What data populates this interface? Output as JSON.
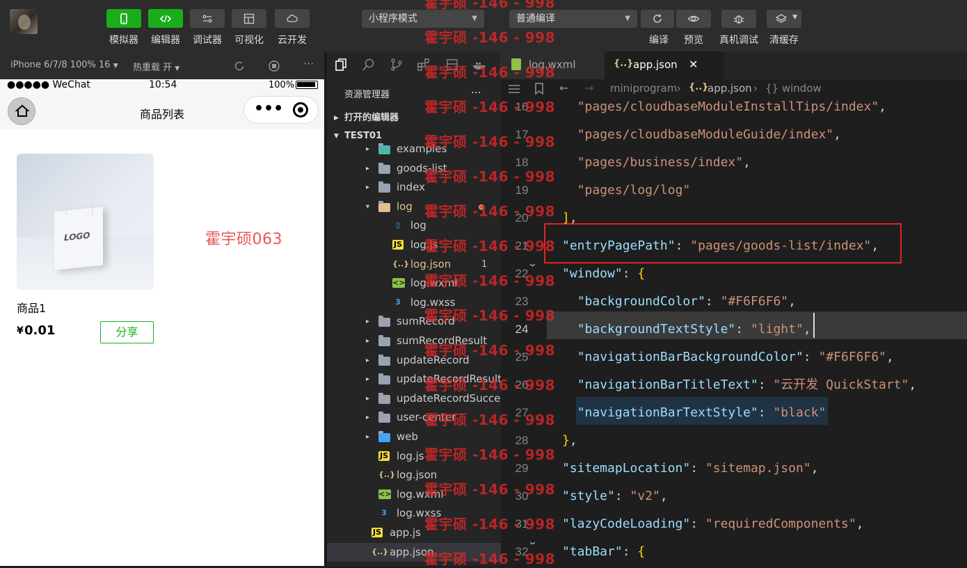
{
  "toolbar": {
    "buttons": [
      {
        "label": "模拟器",
        "icon": "phone-icon",
        "active": true
      },
      {
        "label": "编辑器",
        "icon": "code-icon",
        "active": true
      },
      {
        "label": "调试器",
        "icon": "debug-icon",
        "active": false
      },
      {
        "label": "可视化",
        "icon": "layout-icon",
        "active": false
      },
      {
        "label": "云开发",
        "icon": "cloud-icon",
        "active": false
      }
    ],
    "mode_select": "小程序模式",
    "compile_select": "普通编译",
    "actions": [
      {
        "label": "编译",
        "icon": "refresh-icon"
      },
      {
        "label": "预览",
        "icon": "eye-icon"
      },
      {
        "label": "真机调试",
        "icon": "bug-icon"
      },
      {
        "label": "清缓存",
        "icon": "layers-icon"
      }
    ]
  },
  "watermark": {
    "text": "霍宇硕 -146 - 998",
    "phone_text": "霍宇硕063"
  },
  "simulator": {
    "device": "iPhone 6/7/8 100% 16",
    "hot_reload": "热重载 开",
    "status": {
      "carrier": "●●●●● WeChat",
      "time": "10:54",
      "battery": "100%"
    },
    "nav_title": "商品列表",
    "product": {
      "name": "商品1",
      "price_symbol": "¥",
      "price": "0.01",
      "share": "分享",
      "logo": "LOGO"
    }
  },
  "explorer": {
    "title": "资源管理器",
    "more": "...",
    "open_editors": "打开的编辑器",
    "project": "TEST01",
    "items": [
      {
        "label": "examples",
        "type": "folder-special",
        "indent": 1,
        "chev": "▸"
      },
      {
        "label": "goods-list",
        "type": "folder",
        "indent": 1,
        "chev": "▸"
      },
      {
        "label": "index",
        "type": "folder",
        "indent": 1,
        "chev": "▸"
      },
      {
        "label": "log",
        "type": "folder-open",
        "indent": 1,
        "chev": "▾",
        "color": "#e2c08d",
        "dot": true
      },
      {
        "label": "log",
        "type": "file",
        "indent": 2
      },
      {
        "label": "log.js",
        "type": "js",
        "indent": 2
      },
      {
        "label": "log.json",
        "type": "json",
        "indent": 2,
        "color": "#e2c08d",
        "badge": "1"
      },
      {
        "label": "log.wxml",
        "type": "wxml",
        "indent": 2
      },
      {
        "label": "log.wxss",
        "type": "wxss",
        "indent": 2
      },
      {
        "label": "sumRecord",
        "type": "folder",
        "indent": 1,
        "chev": "▸"
      },
      {
        "label": "sumRecordResult",
        "type": "folder",
        "indent": 1,
        "chev": "▸"
      },
      {
        "label": "updateRecord",
        "type": "folder",
        "indent": 1,
        "chev": "▸"
      },
      {
        "label": "updateRecordResult",
        "type": "folder",
        "indent": 1,
        "chev": "▸"
      },
      {
        "label": "updateRecordSuccess",
        "type": "folder",
        "indent": 1,
        "chev": "▸"
      },
      {
        "label": "user-center",
        "type": "folder",
        "indent": 1,
        "chev": "▸"
      },
      {
        "label": "web",
        "type": "folder-web",
        "indent": 1,
        "chev": "▸"
      },
      {
        "label": "log.js",
        "type": "js",
        "indent": 1
      },
      {
        "label": "log.json",
        "type": "json",
        "indent": 1
      },
      {
        "label": "log.wxml",
        "type": "wxml",
        "indent": 1
      },
      {
        "label": "log.wxss",
        "type": "wxss",
        "indent": 1
      },
      {
        "label": "app.js",
        "type": "js",
        "indent": 0
      },
      {
        "label": "app.json",
        "type": "json",
        "indent": 0,
        "selected": true
      }
    ]
  },
  "editor": {
    "tabs": [
      {
        "label": "log.wxml",
        "active": false
      },
      {
        "label": "app.json",
        "active": true,
        "close": "✕"
      }
    ],
    "breadcrumb": [
      "miniprogram",
      "app.json",
      "{} window"
    ],
    "lines": [
      {
        "n": "16",
        "text": "  \"pages/cloudbaseModuleInstallTips/index\","
      },
      {
        "n": "17",
        "text": "  \"pages/cloudbaseModuleGuide/index\","
      },
      {
        "n": "18",
        "text": "  \"pages/business/index\","
      },
      {
        "n": "19",
        "text": "  \"pages/log/log\""
      },
      {
        "n": "20",
        "text": "],"
      },
      {
        "n": "21",
        "text": "\"entryPagePath\": \"pages/goods-list/index\","
      },
      {
        "n": "22",
        "text": "\"window\": {"
      },
      {
        "n": "23",
        "text": "  \"backgroundColor\": \"#F6F6F6\","
      },
      {
        "n": "24",
        "text": "  \"backgroundTextStyle\": \"light\","
      },
      {
        "n": "25",
        "text": "  \"navigationBarBackgroundColor\": \"#F6F6F6\","
      },
      {
        "n": "26",
        "text": "  \"navigationBarTitleText\": \"云开发 QuickStart\","
      },
      {
        "n": "27",
        "text": "  \"navigationBarTextStyle\": \"black\""
      },
      {
        "n": "28",
        "text": "},"
      },
      {
        "n": "29",
        "text": "\"sitemapLocation\": \"sitemap.json\","
      },
      {
        "n": "30",
        "text": "\"style\": \"v2\","
      },
      {
        "n": "31",
        "text": "\"lazyCodeLoading\": \"requiredComponents\","
      },
      {
        "n": "32",
        "text": "\"tabBar\": {"
      }
    ],
    "current_line": "24"
  },
  "colors": {
    "accent_green": "#1aad19",
    "highlight_box": "#e02424",
    "json_key": "#9cdcfe",
    "json_string": "#ce9178"
  }
}
